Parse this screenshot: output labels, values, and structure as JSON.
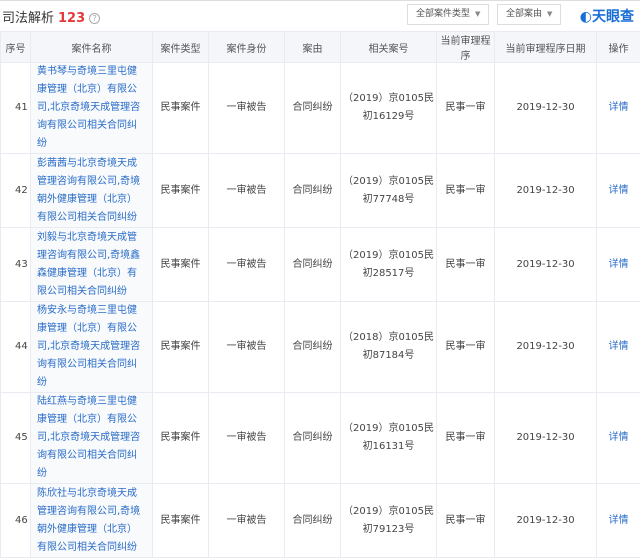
{
  "header": {
    "title": "司法解析",
    "count": "123",
    "help_icon": "?",
    "filter_type": "全部案件类型",
    "filter_cause": "全部案由",
    "logo": "天眼查"
  },
  "columns": [
    "序号",
    "案件名称",
    "案件类型",
    "案件身份",
    "案由",
    "相关案号",
    "当前审理程序",
    "当前审理程序日期",
    "操作"
  ],
  "rows": [
    {
      "no": "41",
      "name": "黄书琴与奇境三里屯健康管理（北京）有限公司,北京奇境天成管理咨询有限公司相关合同纠纷",
      "type": "民事案件",
      "role": "一审被告",
      "cause": "合同纠纷",
      "case_no": "（2019）京0105民初16129号",
      "stage": "民事一审",
      "date": "2019-12-30",
      "action": "详情"
    },
    {
      "no": "42",
      "name": "彭茜茜与北京奇境天成管理咨询有限公司,奇境朝外健康管理（北京）有限公司相关合同纠纷",
      "type": "民事案件",
      "role": "一审被告",
      "cause": "合同纠纷",
      "case_no": "（2019）京0105民初77748号",
      "stage": "民事一审",
      "date": "2019-12-30",
      "action": "详情"
    },
    {
      "no": "43",
      "name": "刘毅与北京奇境天成管理咨询有限公司,奇境鑫森健康管理（北京）有限公司相关合同纠纷",
      "type": "民事案件",
      "role": "一审被告",
      "cause": "合同纠纷",
      "case_no": "（2019）京0105民初28517号",
      "stage": "民事一审",
      "date": "2019-12-30",
      "action": "详情"
    },
    {
      "no": "44",
      "name": "杨安永与奇境三里屯健康管理（北京）有限公司,北京奇境天成管理咨询有限公司相关合同纠纷",
      "type": "民事案件",
      "role": "一审被告",
      "cause": "合同纠纷",
      "case_no": "（2018）京0105民初87184号",
      "stage": "民事一审",
      "date": "2019-12-30",
      "action": "详情"
    },
    {
      "no": "45",
      "name": "陆红燕与奇境三里屯健康管理（北京）有限公司,北京奇境天成管理咨询有限公司相关合同纠纷",
      "type": "民事案件",
      "role": "一审被告",
      "cause": "合同纠纷",
      "case_no": "（2019）京0105民初16131号",
      "stage": "民事一审",
      "date": "2019-12-30",
      "action": "详情"
    },
    {
      "no": "46",
      "name": "陈欣社与北京奇境天成管理咨询有限公司,奇境朝外健康管理（北京）有限公司相关合同纠纷",
      "type": "民事案件",
      "role": "一审被告",
      "cause": "合同纠纷",
      "case_no": "（2019）京0105民初79123号",
      "stage": "民事一审",
      "date": "2019-12-30",
      "action": "详情"
    }
  ]
}
